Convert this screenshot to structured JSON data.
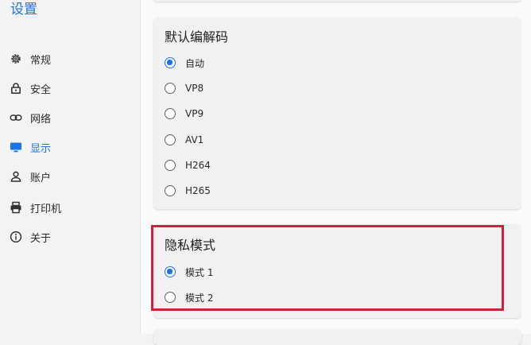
{
  "sidebar": {
    "title": "设置",
    "items": [
      {
        "label": "常规",
        "icon": "gear-icon"
      },
      {
        "label": "安全",
        "icon": "lock-icon"
      },
      {
        "label": "网络",
        "icon": "link-icon"
      },
      {
        "label": "显示",
        "icon": "monitor-icon",
        "active": true
      },
      {
        "label": "账户",
        "icon": "user-icon"
      },
      {
        "label": "打印机",
        "icon": "printer-icon"
      },
      {
        "label": "关于",
        "icon": "info-icon"
      }
    ]
  },
  "codec_section": {
    "title": "默认编解码",
    "options": [
      "自动",
      "VP8",
      "VP9",
      "AV1",
      "H264",
      "H265"
    ],
    "selected": "自动"
  },
  "privacy_section": {
    "title": "隐私模式",
    "options": [
      "模式 1",
      "模式 2"
    ],
    "selected": "模式 1"
  },
  "colors": {
    "accent": "#1a73e8",
    "highlight": "#d11f3c"
  }
}
